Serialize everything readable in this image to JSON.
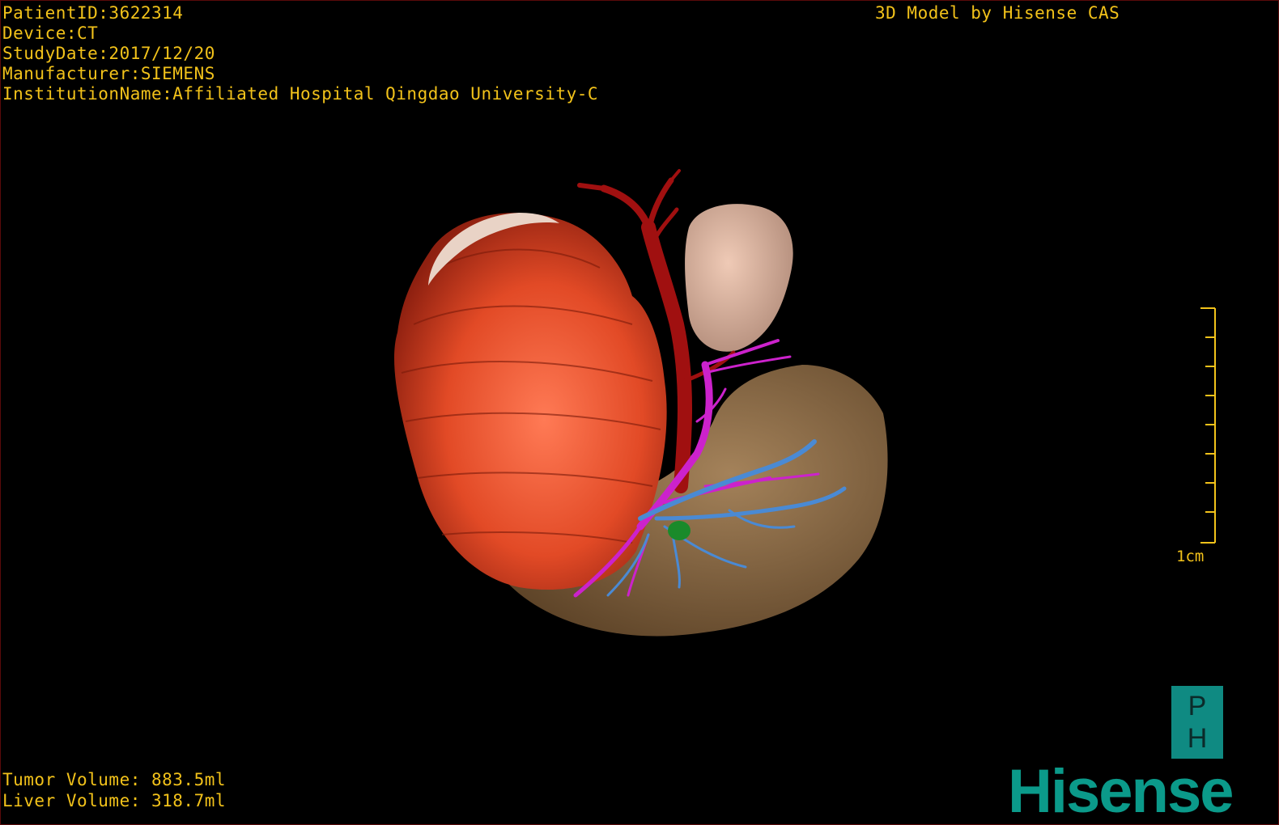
{
  "header": {
    "patient_id": "PatientID:3622314",
    "device": "Device:CT",
    "study_date": "StudyDate:2017/12/20",
    "manufacturer": "Manufacturer:SIEMENS",
    "institution": "InstitutionName:Affiliated Hospital Qingdao University-C",
    "model_credit": "3D Model by Hisense CAS"
  },
  "scale": {
    "label": "1cm",
    "color": "#f2c21a"
  },
  "volumes": {
    "tumor": "Tumor Volume: 883.5ml",
    "liver": "Liver Volume: 318.7ml"
  },
  "logo": {
    "badge_top": "P",
    "badge_bottom": "H",
    "brand": "Hisense",
    "brand_color": "#0b9a8a"
  },
  "colors": {
    "overlay_text": "#f2c21a",
    "tumor": "#e24a26",
    "liver": "#8c6a46",
    "kidney": "#d9b3a0",
    "artery": "#a01010",
    "portal_vein": "#cc22cc",
    "hepatic_vein": "#4a8ad4",
    "gallbladder": "#1a8a2a"
  }
}
